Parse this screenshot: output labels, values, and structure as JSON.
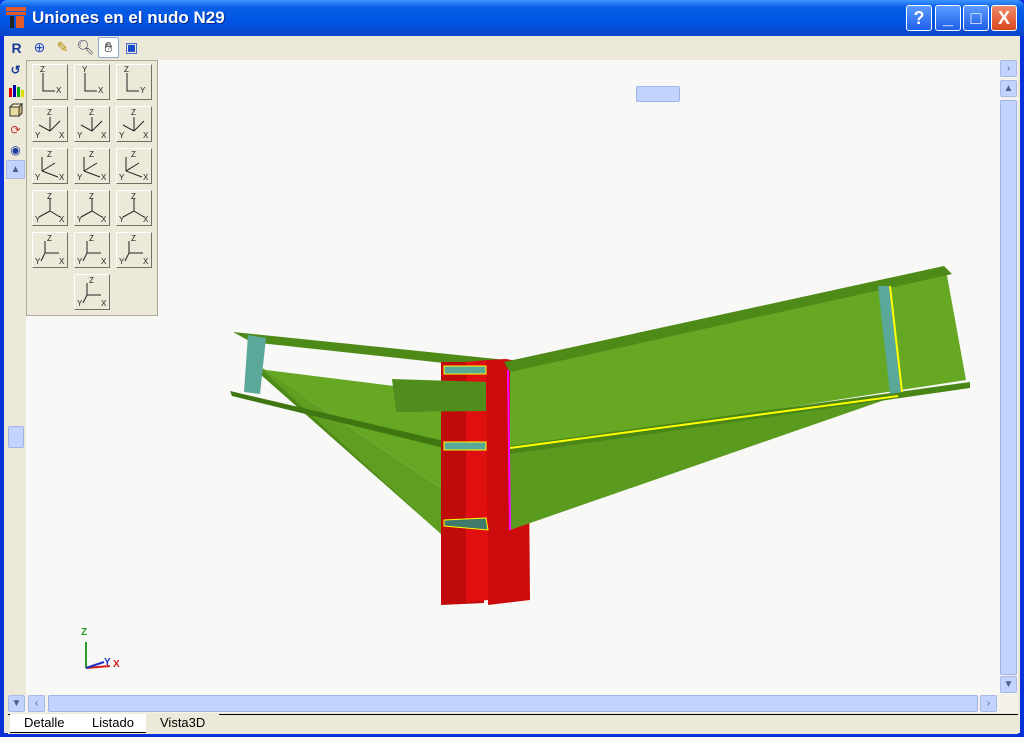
{
  "window": {
    "title": "Uniones en el nudo N29",
    "buttons": [
      "?",
      "_",
      "□",
      "X"
    ]
  },
  "toolbar": {
    "items": [
      "pan-rotate",
      "zoom-all",
      "edit",
      "zoom-window",
      "hand",
      "window-export"
    ],
    "active": "hand"
  },
  "side_toolbar": {
    "items": [
      "rotate",
      "colors",
      "solid",
      "orbit",
      "visibility",
      "scroll-up"
    ]
  },
  "views": [
    [
      "Z",
      "X",
      ""
    ],
    [
      "Y",
      "X",
      ""
    ],
    [
      "Z",
      "Y",
      ""
    ],
    [
      "Z",
      "X",
      "Y"
    ],
    [
      "Z",
      "X",
      "Y"
    ],
    [
      "Z",
      "X",
      "Y"
    ],
    [
      "Z",
      "X",
      "Y"
    ],
    [
      "Z",
      "X",
      "Y"
    ],
    [
      "Z",
      "X",
      "Y"
    ],
    [
      "Z",
      "X",
      "Y"
    ],
    [
      "Z",
      "X",
      "Y"
    ],
    [
      "Z",
      "X",
      "Y"
    ],
    [
      "Z",
      "X",
      "Y"
    ],
    [
      "Z",
      "X",
      "Y"
    ],
    [
      "Z",
      "X",
      "Y"
    ],
    [
      "Z",
      "X",
      "Y"
    ]
  ],
  "axes": {
    "z": "Z",
    "y": "Y",
    "x": "X"
  },
  "tabs": [
    "Detalle",
    "Listado",
    "Vista3D"
  ],
  "active_tab": "Vista3D",
  "colors": {
    "beam": "#5c9e1e",
    "column": "#d40e0e",
    "plate": "#5aa89a",
    "weld": "#ffff00",
    "edge": "#ff00ff"
  }
}
